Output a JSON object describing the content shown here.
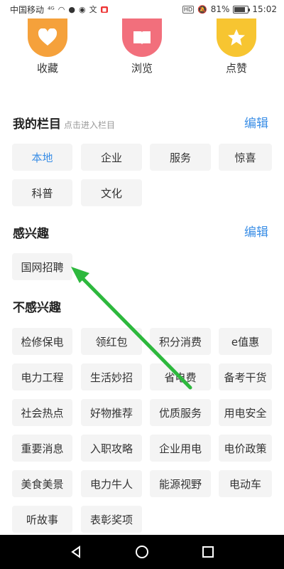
{
  "status_bar": {
    "carrier": "中国移动",
    "signal": "⁴ᴳ",
    "battery_pct": "81%",
    "battery_level": 0.81,
    "time": "15:02",
    "hd": "HD"
  },
  "quick_actions": [
    {
      "label": "收藏",
      "icon": "heart-icon",
      "color": "#f5a13b"
    },
    {
      "label": "浏览",
      "icon": "book-icon",
      "color": "#f26f7c"
    },
    {
      "label": "点赞",
      "icon": "star-icon",
      "color": "#f7c531"
    }
  ],
  "my_columns": {
    "title": "我的栏目",
    "hint": "点击进入栏目",
    "edit_label": "编辑",
    "items": [
      "本地",
      "企业",
      "服务",
      "惊喜",
      "科普",
      "文化"
    ]
  },
  "interested": {
    "title": "感兴趣",
    "edit_label": "编辑",
    "items": [
      "国网招聘"
    ]
  },
  "not_interested": {
    "title": "不感兴趣",
    "items": [
      "检修保电",
      "领红包",
      "积分消费",
      "e值惠",
      "电力工程",
      "生活妙招",
      "省电费",
      "备考干货",
      "社会热点",
      "好物推荐",
      "优质服务",
      "用电安全",
      "重要消息",
      "入职攻略",
      "企业用电",
      "电价政策",
      "美食美景",
      "电力牛人",
      "能源视野",
      "电动车",
      "听故事",
      "表彰奖项"
    ]
  },
  "colors": {
    "accent": "#3a8ee6",
    "arrow": "#2db83d"
  }
}
